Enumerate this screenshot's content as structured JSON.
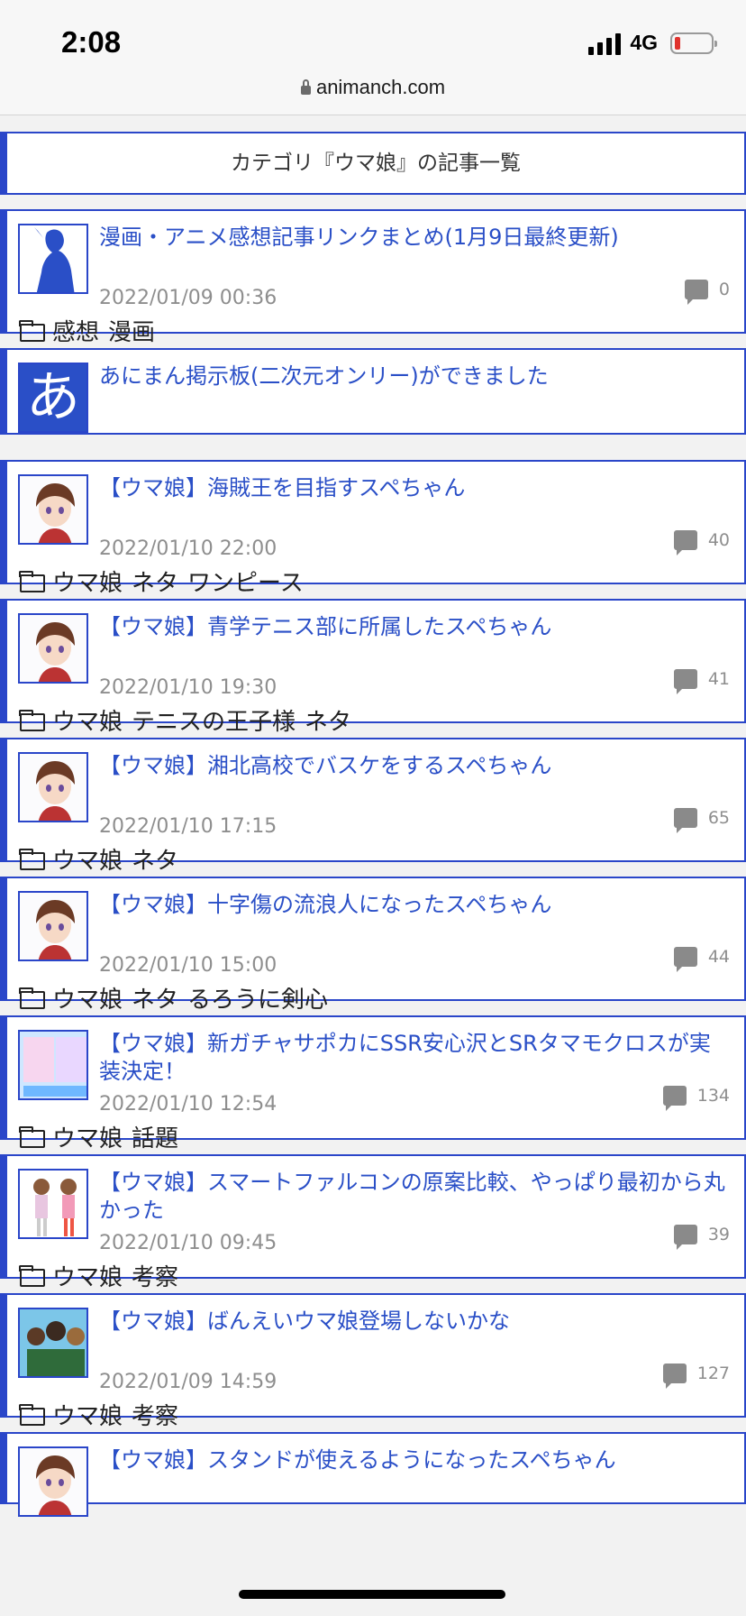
{
  "status": {
    "time": "2:08",
    "network": "4G"
  },
  "browser": {
    "url": "animanch.com"
  },
  "category_header": "カテゴリ『ウマ娘』の記事一覧",
  "articles": [
    {
      "title": "漫画・アニメ感想記事リンクまとめ(1月9日最終更新)",
      "date": "2022/01/09 00:36",
      "comments": "0",
      "tags": [
        "感想",
        "漫画"
      ],
      "thumb": "silhouette-thumbnail"
    },
    {
      "title": "あにまん掲示板(二次元オンリー)ができました",
      "date": "",
      "comments": "",
      "tags": [],
      "thumb": "a-logo-thumbnail"
    },
    {
      "title": "【ウマ娘】海賊王を目指すスペちゃん",
      "date": "2022/01/10 22:00",
      "comments": "40",
      "tags": [
        "ウマ娘",
        "ネタ",
        "ワンピース"
      ],
      "thumb": "anime-girl-thumbnail"
    },
    {
      "title": "【ウマ娘】青学テニス部に所属したスペちゃん",
      "date": "2022/01/10 19:30",
      "comments": "41",
      "tags": [
        "ウマ娘",
        "テニスの王子様",
        "ネタ"
      ],
      "thumb": "anime-girl-thumbnail"
    },
    {
      "title": "【ウマ娘】湘北高校でバスケをするスペちゃん",
      "date": "2022/01/10 17:15",
      "comments": "65",
      "tags": [
        "ウマ娘",
        "ネタ"
      ],
      "thumb": "anime-girl-thumbnail"
    },
    {
      "title": "【ウマ娘】十字傷の流浪人になったスペちゃん",
      "date": "2022/01/10 15:00",
      "comments": "44",
      "tags": [
        "ウマ娘",
        "ネタ",
        "るろうに剣心"
      ],
      "thumb": "anime-girl-thumbnail"
    },
    {
      "title": "【ウマ娘】新ガチャサポカにSSR安心沢とSRタマモクロスが実装決定！",
      "date": "2022/01/10 12:54",
      "comments": "134",
      "tags": [
        "ウマ娘",
        "話題"
      ],
      "thumb": "gacha-banner-thumbnail"
    },
    {
      "title": "【ウマ娘】スマートファルコンの原案比較、やっぱり最初から丸かった",
      "date": "2022/01/10 09:45",
      "comments": "39",
      "tags": [
        "ウマ娘",
        "考察"
      ],
      "thumb": "character-art-thumbnail"
    },
    {
      "title": "【ウマ娘】ばんえいウマ娘登場しないかな",
      "date": "2022/01/09 14:59",
      "comments": "127",
      "tags": [
        "ウマ娘",
        "考察"
      ],
      "thumb": "group-art-thumbnail"
    },
    {
      "title": "【ウマ娘】スタンドが使えるようになったスペちゃん",
      "date": "",
      "comments": "",
      "tags": [],
      "thumb": "anime-girl-thumbnail"
    }
  ]
}
